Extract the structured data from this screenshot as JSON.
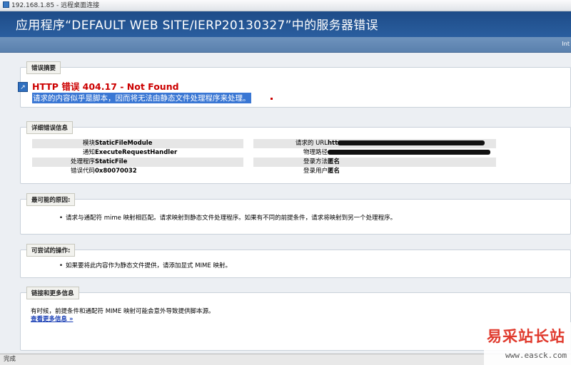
{
  "window": {
    "title": "192.168.1.85 - 远程桌面连接"
  },
  "header": {
    "title": "应用程序“DEFAULT WEB SITE/IERP20130327”中的服务器错误",
    "right_text": "Int"
  },
  "summary": {
    "legend": "错误摘要",
    "error_title": "HTTP 错误 404.17 - Not Found",
    "description": "请求的内容似乎是脚本，因而将无法由静态文件处理程序来处理。"
  },
  "details": {
    "legend": "详细错误信息",
    "left": [
      {
        "label": "模块",
        "value": "StaticFileModule"
      },
      {
        "label": "通知",
        "value": "ExecuteRequestHandler"
      },
      {
        "label": "处理程序",
        "value": "StaticFile"
      },
      {
        "label": "错误代码",
        "value": "0x80070032"
      }
    ],
    "right": [
      {
        "label": "请求的 URL",
        "value": "htt"
      },
      {
        "label": "物理路径",
        "value": ""
      },
      {
        "label": "登录方法",
        "value": "匿名"
      },
      {
        "label": "登录用户",
        "value": "匿名"
      }
    ]
  },
  "causes": {
    "legend": "最可能的原因:",
    "items": [
      "请求与通配符 mime 映射相匹配。请求映射到静态文件处理程序。如果有不同的前提条件，请求将映射到另一个处理程序。"
    ]
  },
  "actions": {
    "legend": "可尝试的操作:",
    "items": [
      "如果要将此内容作为静态文件提供，请添加显式 MIME 映射。"
    ]
  },
  "links": {
    "legend": "链接和更多信息",
    "text": "有时候，前提条件和通配符 MIME 映射可能会意外导致提供脚本源。",
    "link": "查看更多信息 »"
  },
  "status": {
    "text": "完成"
  },
  "watermark": {
    "brand": "易采站长站",
    "domain": "www.easck.com"
  },
  "colors": {
    "header_blue": "#1e4c88",
    "error_red": "#cc0000",
    "selection_blue": "#3a77d4"
  }
}
